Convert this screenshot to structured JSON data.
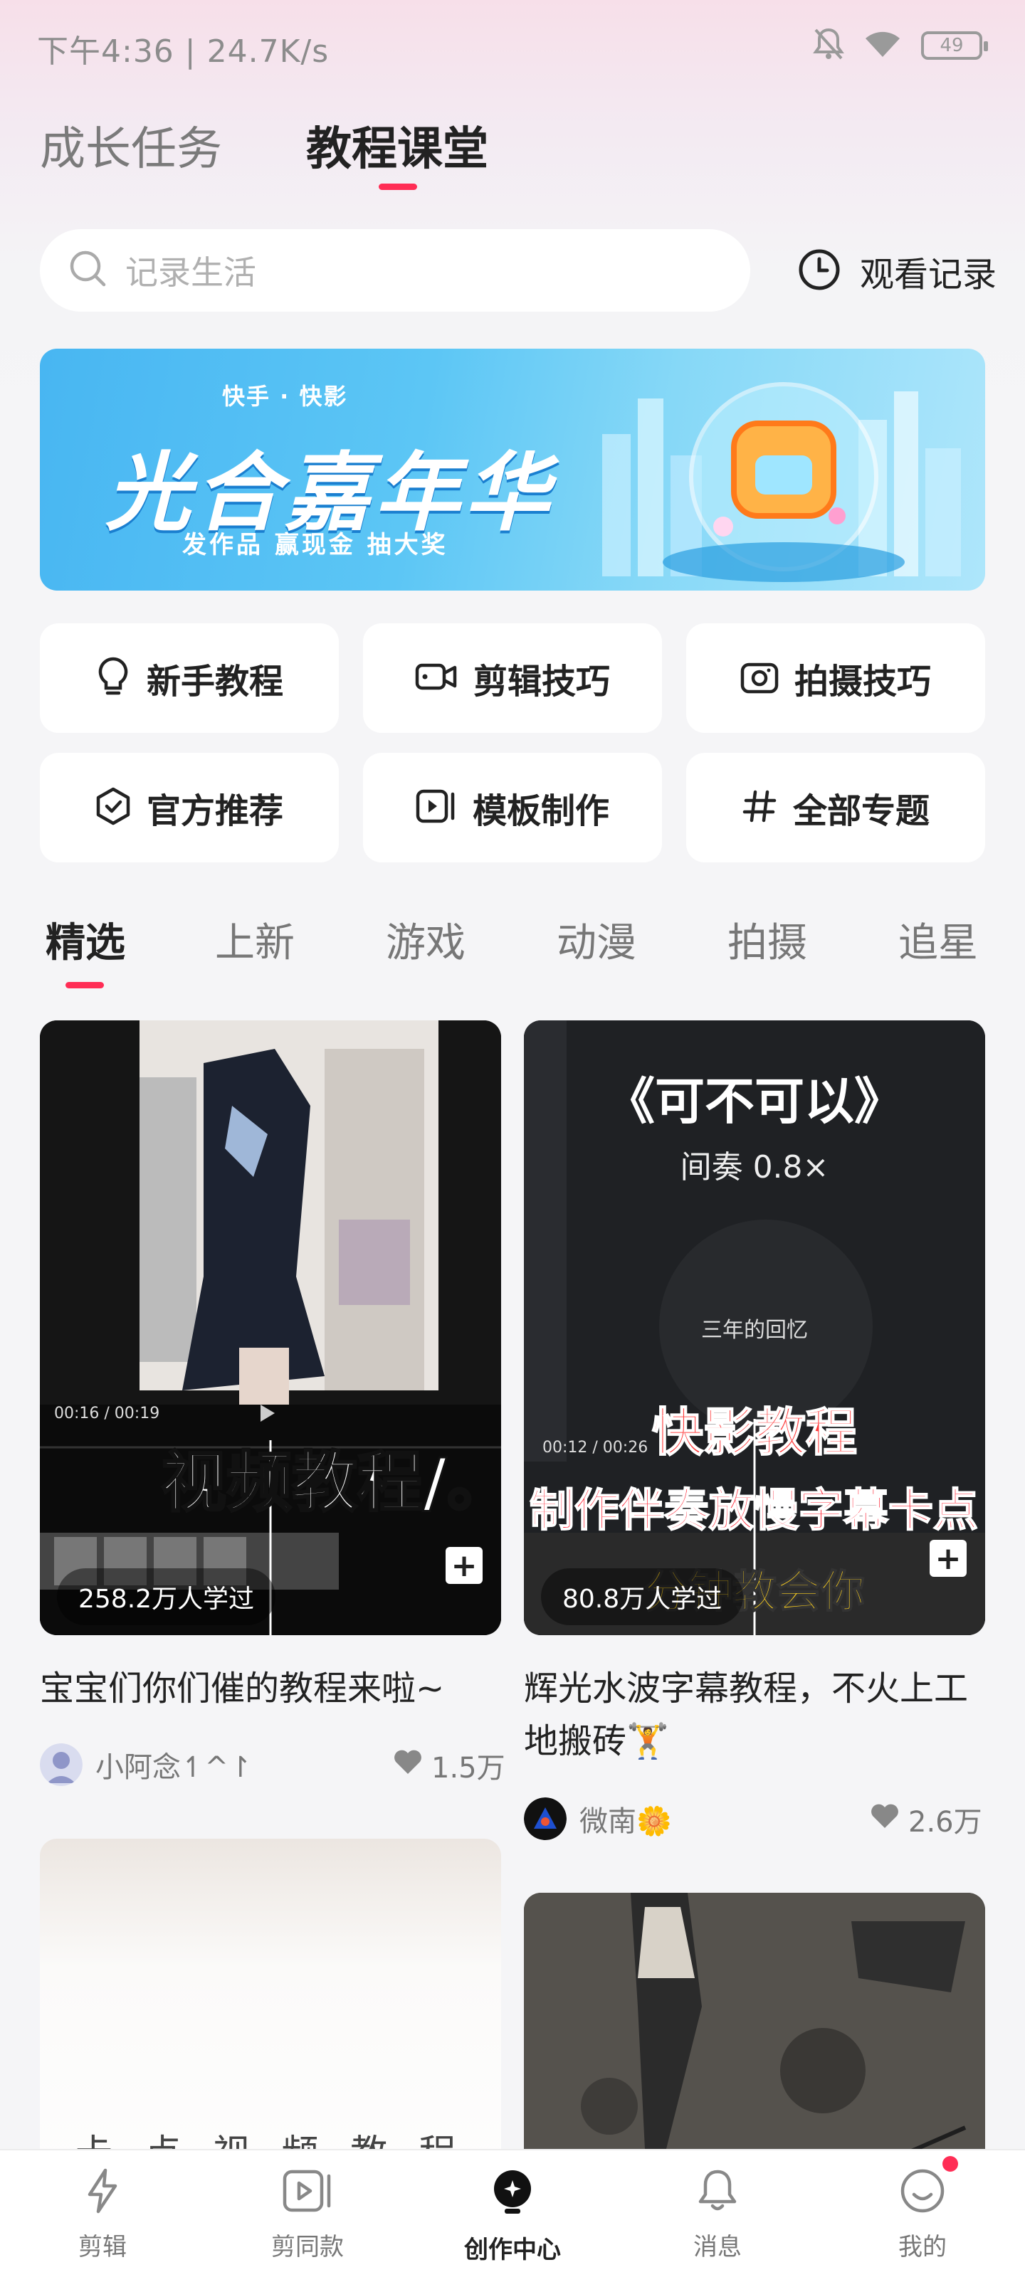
{
  "status_bar": {
    "text": "下午4:36 | 24.7K/s",
    "battery": "49"
  },
  "top_tabs": [
    {
      "label": "成长任务"
    },
    {
      "label": "教程课堂"
    }
  ],
  "search": {
    "placeholder": "记录生活"
  },
  "history": {
    "label": "观看记录"
  },
  "banner": {
    "logo": "快手 · 快影",
    "title": "光合嘉年华",
    "subtitle": "发作品  赢现金  抽大奖"
  },
  "categories": [
    {
      "label": "新手教程",
      "icon": "lightbulb-icon"
    },
    {
      "label": "剪辑技巧",
      "icon": "video-camera-icon"
    },
    {
      "label": "拍摄技巧",
      "icon": "camera-icon"
    },
    {
      "label": "官方推荐",
      "icon": "shield-check-icon"
    },
    {
      "label": "模板制作",
      "icon": "video-template-icon"
    },
    {
      "label": "全部专题",
      "icon": "hashtag-icon"
    }
  ],
  "content_tabs": [
    {
      "label": "精选"
    },
    {
      "label": "上新"
    },
    {
      "label": "游戏"
    },
    {
      "label": "动漫"
    },
    {
      "label": "拍摄"
    },
    {
      "label": "追星"
    }
  ],
  "cards": [
    {
      "thumb_timecode": "00:16 / 00:19",
      "thumb_overlay": "视频教程/。",
      "learners": "258.2万人学过",
      "title": "宝宝们你们催的教程来啦~",
      "author": "小阿念↿^↾",
      "likes": "1.5万"
    },
    {
      "thumb_song": "《可不可以》",
      "thumb_tempo": "间奏 0.8×",
      "thumb_lyric": "三年的回忆",
      "thumb_timecode": "00:12 / 00:26",
      "thumb_brand": "快影教程",
      "thumb_headline": "制作伴奏放慢字幕卡点",
      "thumb_tagline": "分钟教会你",
      "learners": "80.8万人学过",
      "title": "辉光水波字幕教程，不火上工地搬砖🏋",
      "author": "微南🌼",
      "likes": "2.6万"
    },
    {
      "thumb_overlay": "卡 点 视 频 教 程"
    },
    {}
  ],
  "bottom_nav": [
    {
      "label": "剪辑"
    },
    {
      "label": "剪同款"
    },
    {
      "label": "创作中心"
    },
    {
      "label": "消息"
    },
    {
      "label": "我的"
    }
  ],
  "colors": {
    "accent": "#ff2d55"
  }
}
